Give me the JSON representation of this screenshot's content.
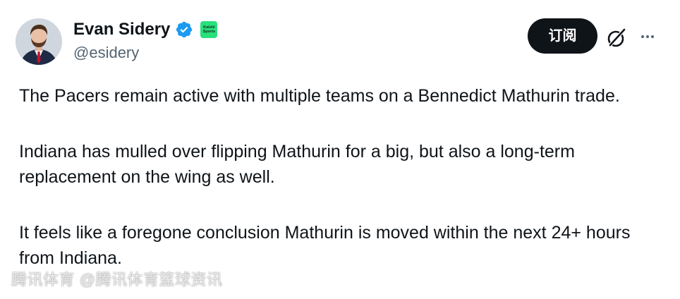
{
  "author": {
    "display_name": "Evan Sidery",
    "handle": "@esidery",
    "verified_icon": "verified-badge-icon",
    "affiliate_badge": {
      "line1": "Kalshi",
      "line2": "Sports",
      "color": "#28e07c"
    }
  },
  "actions": {
    "subscribe_label": "订阅",
    "grok_icon": "grok-icon",
    "more_icon": "more-icon"
  },
  "tweet": {
    "paragraphs": [
      "The Pacers remain active with multiple teams on a Bennedict Mathurin trade.",
      "Indiana has mulled over flipping Mathurin for a big, but also a long-term replacement on the wing as well.",
      "It feels like a foregone conclusion Mathurin is moved within the next 24+ hours from Indiana."
    ]
  },
  "watermark": "腾讯体育 @腾讯体育篮球资讯",
  "colors": {
    "text_primary": "#0f1419",
    "text_secondary": "#536471",
    "verified_blue": "#1d9bf0",
    "button_bg": "#0f1419"
  }
}
